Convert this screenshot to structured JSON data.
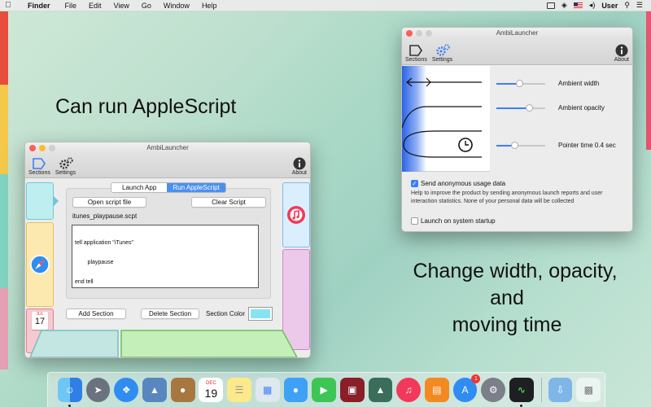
{
  "menubar": {
    "app_name": "Finder",
    "menus": [
      "File",
      "Edit",
      "View",
      "Go",
      "Window",
      "Help"
    ],
    "user": "User"
  },
  "captions": {
    "apple_script": "Can run AppleScript",
    "change_line1": "Change width, opacity,",
    "change_line2": "and",
    "change_line3": "moving time"
  },
  "main_window": {
    "title": "AmbiLauncher",
    "toolbar": {
      "sections": "Sections",
      "settings": "Settings",
      "about": "About"
    },
    "tabs": [
      "Launch App",
      "Run AppleScript"
    ],
    "selected_tab": "Run AppleScript",
    "open_script_button": "Open script file",
    "clear_script_button": "Clear Script",
    "script_file_name": "itunes_playpause.scpt",
    "script_lines": [
      "tell application \"iTunes\"",
      "        playpause",
      "end tell"
    ],
    "add_section_button": "Add Section",
    "delete_section_button": "Delete Section",
    "section_color_label": "Section Color",
    "section_color": "#86e3f5",
    "calendar_month": "JUL",
    "calendar_day": "17"
  },
  "settings_window": {
    "title": "AmbiLauncher",
    "toolbar": {
      "sections": "Sections",
      "settings": "Settings",
      "about": "About"
    },
    "sliders": [
      {
        "label": "Ambient width",
        "value": 0.45
      },
      {
        "label": "Ambient opacity",
        "value": 0.65
      },
      {
        "label": "Pointer time 0.4 sec",
        "value": 0.35
      }
    ],
    "usage_checkbox_label": "Send anonymous usage data",
    "usage_checked": true,
    "usage_help": "Help to improve the product by sending anonymous launch reports and user interaction statistics. None of your personal data will be collected",
    "startup_checkbox_label": "Launch on system startup",
    "startup_checked": false
  },
  "dock": {
    "calendar_month": "DEC",
    "calendar_day": "19",
    "appstore_badge": "1"
  },
  "colors": {
    "accent": "#3b7ff5",
    "selected_tab": "#4a90f0",
    "section_cyan": "#bfeef0",
    "section_yellow": "#fbe9b0",
    "section_pink": "#f5c9cf",
    "section_lavender": "#ecc8ea",
    "section_green": "#c4efb9",
    "section_teal": "#c3e6e3"
  }
}
